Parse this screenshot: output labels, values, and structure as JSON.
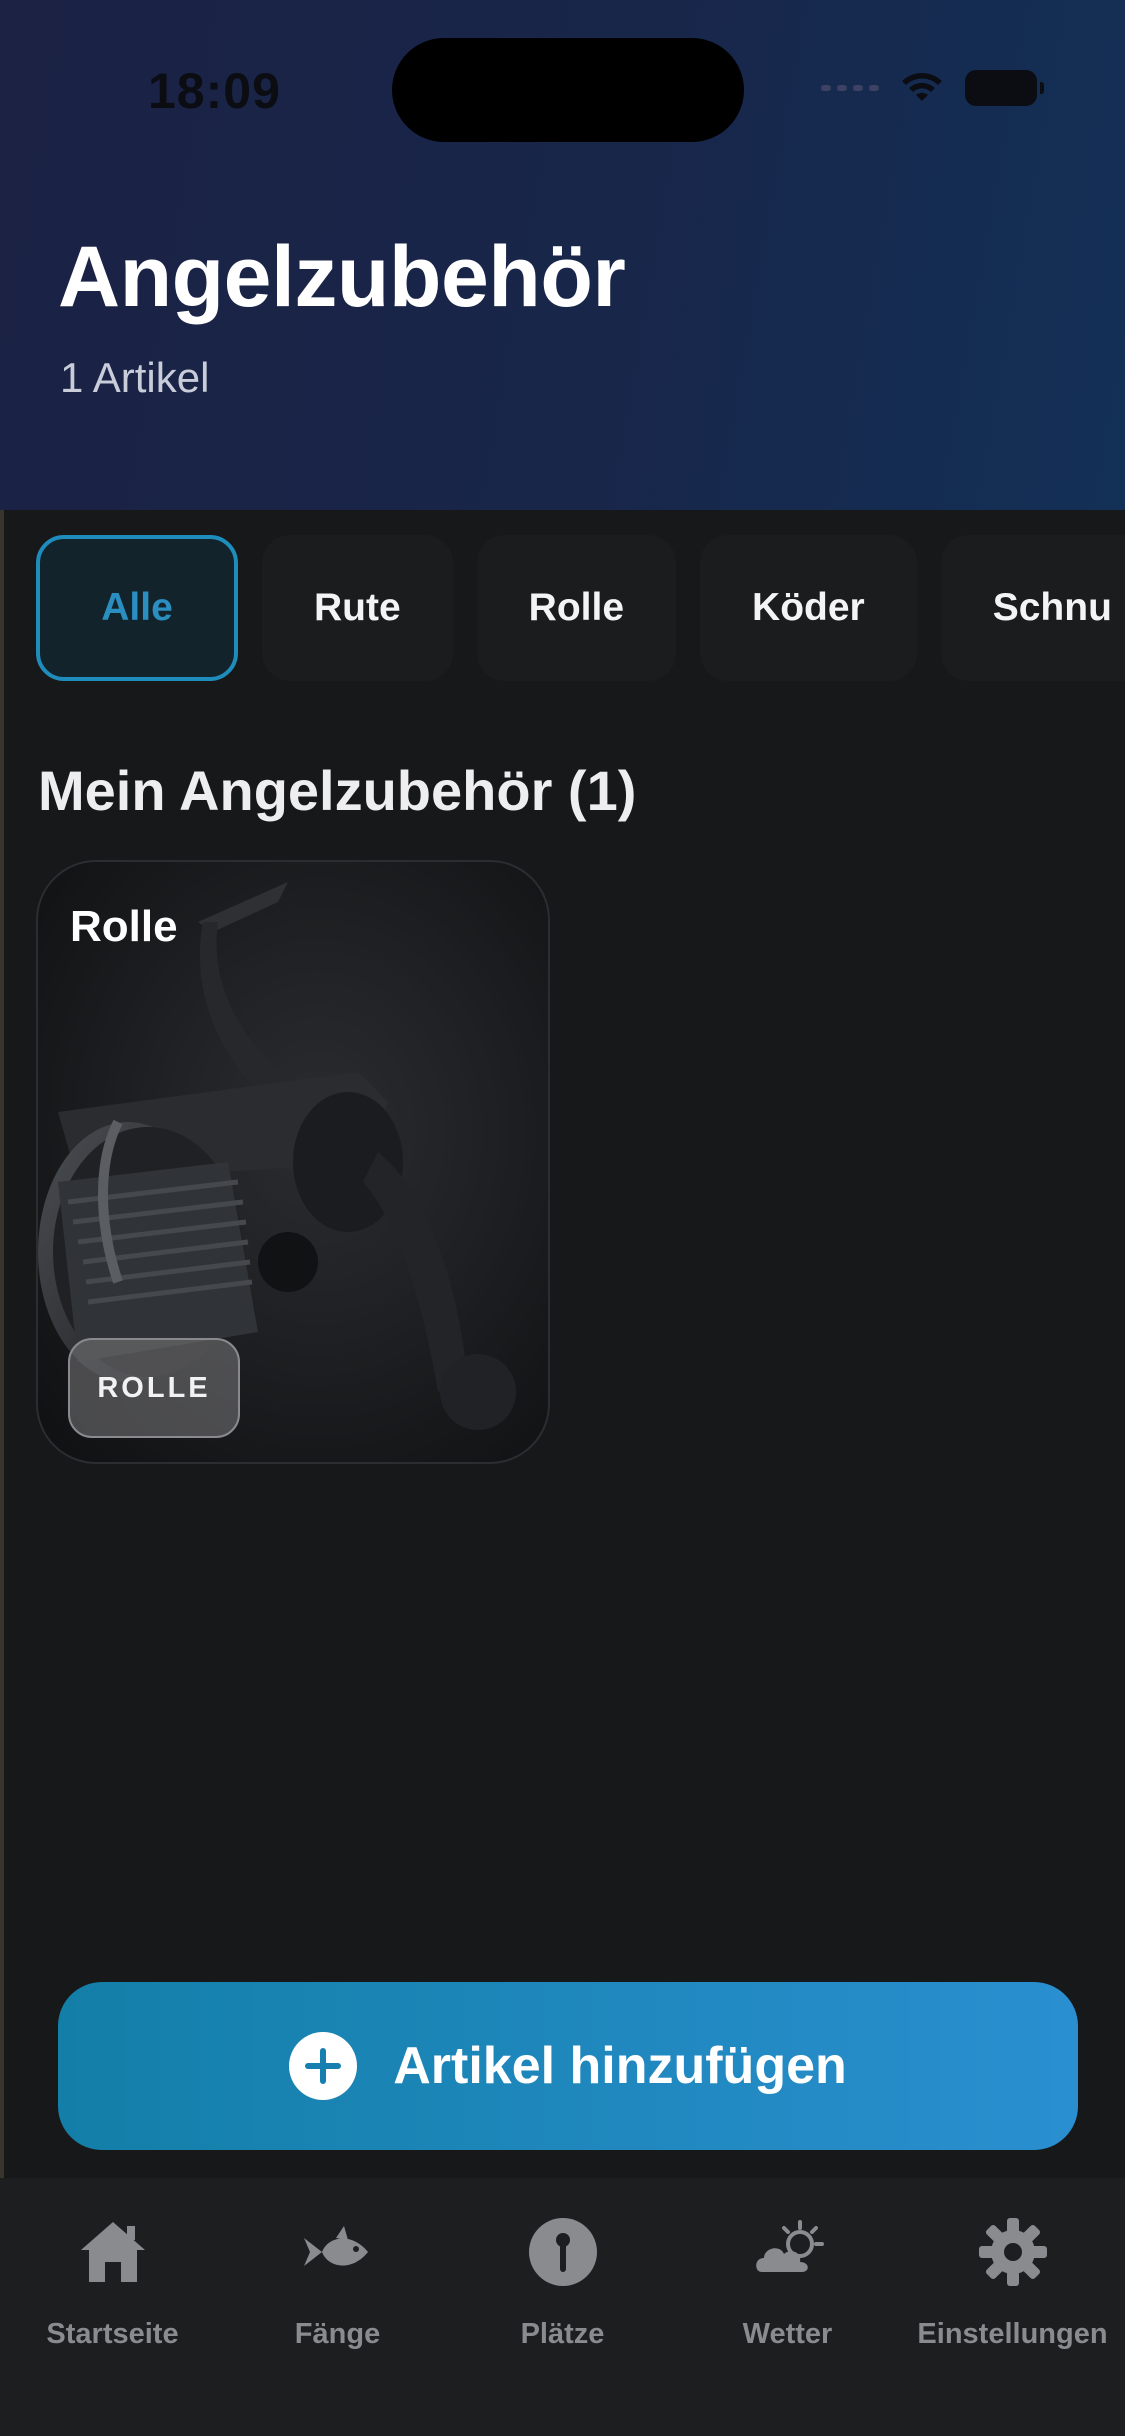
{
  "status_bar": {
    "time": "18:09"
  },
  "header": {
    "title": "Angelzubehör",
    "subtitle": "1 Artikel"
  },
  "filters": [
    {
      "label": "Alle",
      "active": true
    },
    {
      "label": "Rute",
      "active": false
    },
    {
      "label": "Rolle",
      "active": false
    },
    {
      "label": "Köder",
      "active": false
    },
    {
      "label": "Schnu",
      "active": false
    }
  ],
  "section": {
    "title": "Mein Angelzubehör (1)"
  },
  "items": [
    {
      "title": "Rolle",
      "category_badge": "ROLLE",
      "icon": "fishing-reel-image"
    }
  ],
  "add_button": {
    "label": "Artikel hinzufügen",
    "icon": "plus-circle-icon"
  },
  "tabbar": [
    {
      "label": "Startseite",
      "icon": "home-icon"
    },
    {
      "label": "Fänge",
      "icon": "fish-icon"
    },
    {
      "label": "Plätze",
      "icon": "map-pin-icon"
    },
    {
      "label": "Wetter",
      "icon": "weather-icon"
    },
    {
      "label": "Einstellungen",
      "icon": "gear-icon"
    }
  ],
  "colors": {
    "accent": "#1e8dbb",
    "header_bg": "#1b2244",
    "background": "#171819",
    "button": "#1a86b8"
  }
}
